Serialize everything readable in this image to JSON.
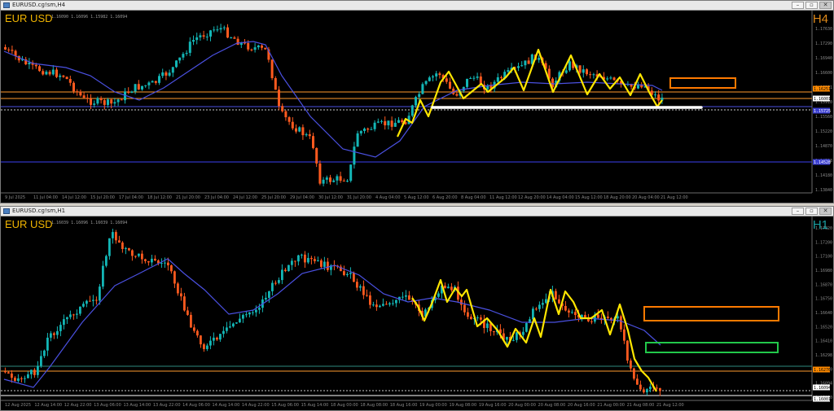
{
  "windows": [
    {
      "title": "EURUSD.cg!sm,H4",
      "symbol": "EUR USD",
      "ohlc": "1.16090 1.16096 1.15982 1.16094",
      "timeframe": "H4",
      "price_labels": [
        "1.17630",
        "1.17290",
        "1.16940",
        "1.16600",
        "1.16251",
        "1.15910",
        "1.15560",
        "1.15220",
        "1.14870",
        "1.14528",
        "1.14180",
        "1.13840"
      ],
      "highlight_prices": [
        "1.16251",
        "1.16001",
        "1.15725",
        "1.14528"
      ],
      "time_labels": [
        "9 Jul 2025",
        "11 Jul 04:00",
        "14 Jul 12:00",
        "15 Jul 20:00",
        "17 Jul 04:00",
        "18 Jul 12:00",
        "21 Jul 20:00",
        "23 Jul 04:00",
        "24 Jul 12:00",
        "25 Jul 20:00",
        "29 Jul 04:00",
        "30 Jul 12:00",
        "31 Jul 20:00",
        "4 Aug 04:00",
        "5 Aug 12:00",
        "6 Aug 20:00",
        "8 Aug 04:00",
        "11 Aug 12:00",
        "12 Aug 20:00",
        "14 Aug 04:00",
        "15 Aug 12:00",
        "18 Aug 20:00",
        "20 Aug 04:00",
        "21 Aug 12:00"
      ]
    },
    {
      "title": "EURUSD.cg!sm,H1",
      "symbol": "EUR USD",
      "ohlc": "1.16039 1.16096 1.16039 1.16094",
      "timeframe": "H1",
      "price_labels": [
        "1.17320",
        "1.17200",
        "1.17100",
        "1.16980",
        "1.16870",
        "1.16750",
        "1.16640",
        "1.16520",
        "1.16410",
        "1.16298",
        "1.16180",
        "1.16094",
        "1.15950"
      ],
      "highlight_prices": [
        "1.16276",
        "1.16094",
        "1.16001"
      ],
      "time_labels": [
        "12 Aug 2025",
        "12 Aug 14:00",
        "12 Aug 22:00",
        "13 Aug 06:00",
        "13 Aug 14:00",
        "13 Aug 22:00",
        "14 Aug 06:00",
        "14 Aug 14:00",
        "14 Aug 22:00",
        "15 Aug 06:00",
        "15 Aug 14:00",
        "18 Aug 00:00",
        "18 Aug 08:00",
        "18 Aug 16:00",
        "19 Aug 00:00",
        "19 Aug 08:00",
        "19 Aug 16:00",
        "20 Aug 00:00",
        "20 Aug 08:00",
        "20 Aug 16:00",
        "21 Aug 00:00",
        "21 Aug 08:00",
        "21 Aug 12:00"
      ]
    }
  ],
  "colors": {
    "bull": "#13b6b6",
    "bear": "#ff5a1f",
    "ma": "#4a50e0",
    "zigzag": "#ffe600",
    "orange_box": "#ff7a00",
    "green_box": "#22c84a",
    "level": "#ff9a2e",
    "support": "#ffffff",
    "axis_text": "#8a8a8a"
  }
}
